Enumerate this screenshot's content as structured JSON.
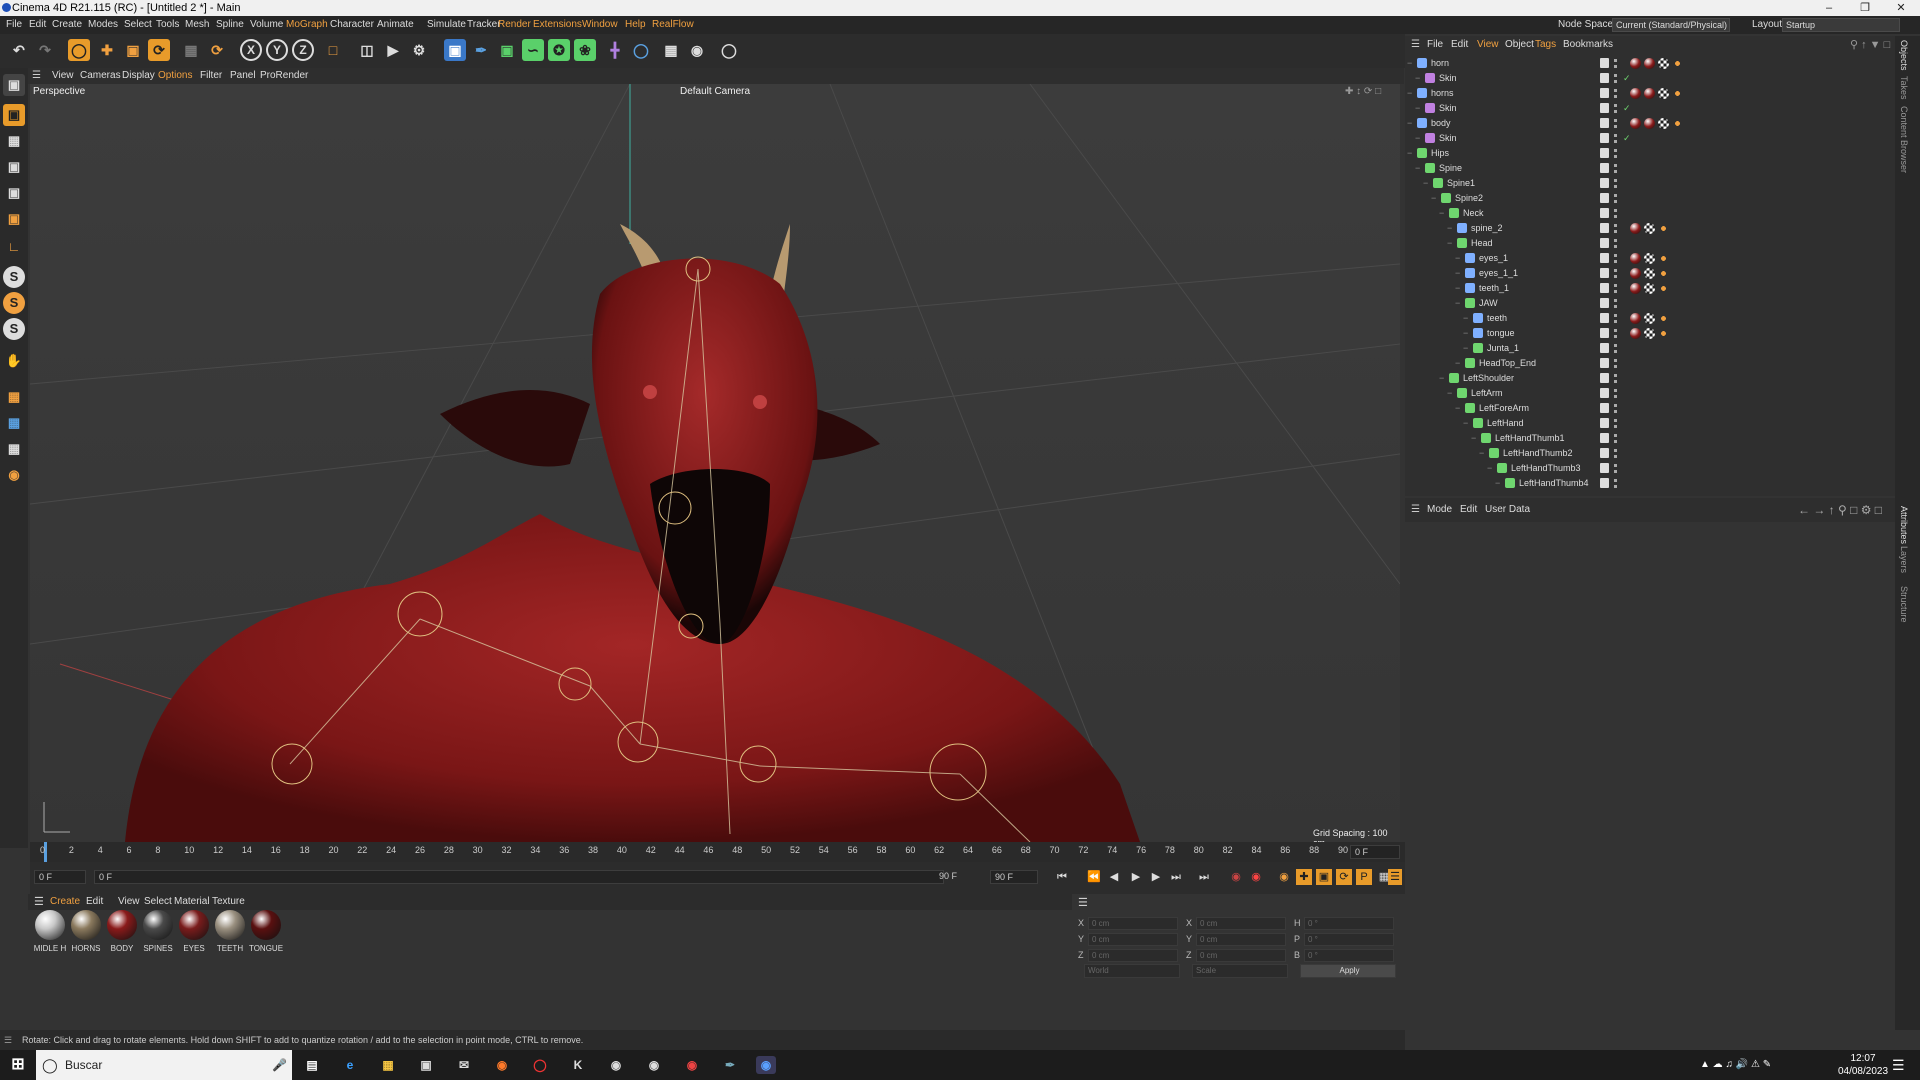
{
  "window": {
    "title": "Cinema 4D R21.115 (RC) - [Untitled 2 *] - Main",
    "controls": [
      "minimize-icon",
      "restore-icon",
      "close-icon"
    ]
  },
  "menubar": {
    "items": [
      "File",
      "Edit",
      "Create",
      "Modes",
      "Select",
      "Tools",
      "Mesh",
      "Spline",
      "Volume",
      "MoGraph",
      "Character",
      "Animate",
      "Simulate",
      "Tracker",
      "Render",
      "Extensions",
      "Window",
      "Help",
      "RealFlow"
    ],
    "node_space_label": "Node Space:",
    "node_space_value": "Current (Standard/Physical)",
    "layout_label": "Layout:",
    "layout_value": "Startup"
  },
  "toolbar": {
    "icons": [
      "undo-icon",
      "redo-icon",
      "live-selection-icon",
      "move-icon",
      "scale-icon",
      "rotate-icon",
      "recent-tools-icon",
      "coordinate-system-icon",
      "x-axis-lock-icon",
      "y-axis-lock-icon",
      "z-axis-lock-icon",
      "world-coordinates-icon",
      "render-region-icon",
      "render-view-icon",
      "render-settings-icon",
      "cube-icon",
      "pen-icon",
      "subdivision-icon",
      "spline-deformer-icon",
      "cloner-icon",
      "mograph-icon",
      "field-icon",
      "floor-icon",
      "camera-icon",
      "light-icon"
    ],
    "axis_labels": [
      "X",
      "Y",
      "Z"
    ]
  },
  "left_tools": [
    "make-editable-icon",
    "checkerboard-icon",
    "points-mode-icon",
    "edges-mode-icon",
    "polygons-mode-icon",
    "uv-mode-icon",
    "axis-mode-icon",
    "snap-icon",
    "soft-selection-icon",
    "workplane-icon",
    "tweak-icon",
    "texture-mode-icon",
    "grid-icon",
    "sculpt-icon",
    "brush-icon"
  ],
  "left_tool_letters": {
    "snap": "S",
    "soft": "S",
    "workplane": "S"
  },
  "viewport": {
    "menu": [
      "View",
      "Cameras",
      "Display",
      "Options",
      "Filter",
      "Panel",
      "ProRender"
    ],
    "active_menu": "Options",
    "view_name": "Perspective",
    "camera": "Default Camera",
    "grid_spacing": "Grid Spacing : 100 cm"
  },
  "timeline": {
    "ticks": [
      "0",
      "2",
      "4",
      "6",
      "8",
      "10",
      "12",
      "14",
      "16",
      "18",
      "20",
      "22",
      "24",
      "26",
      "28",
      "30",
      "32",
      "34",
      "36",
      "38",
      "40",
      "42",
      "44",
      "46",
      "48",
      "50",
      "52",
      "54",
      "56",
      "58",
      "60",
      "62",
      "64",
      "66",
      "68",
      "70",
      "72",
      "74",
      "76",
      "78",
      "80",
      "82",
      "84",
      "86",
      "88",
      "90"
    ],
    "current_frame_display": "0 F"
  },
  "playback": {
    "start_frame": "0 F",
    "current_frame": "0 F",
    "end_frame": "90 F",
    "max_frame": "90 F"
  },
  "materials": {
    "menu": [
      "Create",
      "Edit",
      "View",
      "Select",
      "Material",
      "Texture"
    ],
    "active_menu": "Create",
    "items": [
      {
        "name": "MIDLE H",
        "color": "#c8c8c8"
      },
      {
        "name": "HORNS",
        "color": "#8b7a5e"
      },
      {
        "name": "BODY",
        "color": "#8a1a1a"
      },
      {
        "name": "SPINES",
        "color": "#4a4a4a"
      },
      {
        "name": "EYES",
        "color": "#7a1c1c"
      },
      {
        "name": "TEETH",
        "color": "#9a9080"
      },
      {
        "name": "TONGUE",
        "color": "#5a1010"
      }
    ]
  },
  "coordinates": {
    "rows": [
      {
        "pos_label": "X",
        "pos_value": "0 cm",
        "size_label": "X",
        "size_value": "0 cm",
        "rot_label": "H",
        "rot_value": "0 °"
      },
      {
        "pos_label": "Y",
        "pos_value": "0 cm",
        "size_label": "Y",
        "size_value": "0 cm",
        "rot_label": "P",
        "rot_value": "0 °"
      },
      {
        "pos_label": "Z",
        "pos_value": "0 cm",
        "size_label": "Z",
        "size_value": "0 cm",
        "rot_label": "B",
        "rot_value": "0 °"
      }
    ],
    "space": "World",
    "mode": "Scale",
    "apply": "Apply"
  },
  "status": "Rotate: Click and drag to rotate elements. Hold down SHIFT to add to quantize rotation / add to the selection in point mode, CTRL to remove.",
  "object_manager": {
    "menu": [
      "File",
      "Edit",
      "View",
      "Object",
      "Tags",
      "Bookmarks"
    ],
    "highlight_menu": [
      "View",
      "Tags"
    ],
    "rows": [
      {
        "name": "horn",
        "indent": 0,
        "type": "mesh",
        "tags": [
          "mat-tag",
          "mat-tag",
          "uv-tag",
          "weight-tag"
        ]
      },
      {
        "name": "Skin",
        "indent": 1,
        "type": "skin",
        "tags": []
      },
      {
        "name": "horns",
        "indent": 0,
        "type": "mesh",
        "tags": [
          "mat-tag",
          "mat-tag",
          "uv-tag",
          "weight-tag"
        ]
      },
      {
        "name": "Skin",
        "indent": 1,
        "type": "skin",
        "tags": []
      },
      {
        "name": "body",
        "indent": 0,
        "type": "mesh",
        "tags": [
          "mat-tag",
          "mat-tag",
          "uv-tag",
          "weight-tag"
        ]
      },
      {
        "name": "Skin",
        "indent": 1,
        "type": "skin",
        "tags": []
      },
      {
        "name": "Hips",
        "indent": 0,
        "type": "joint",
        "tags": []
      },
      {
        "name": "Spine",
        "indent": 1,
        "type": "joint",
        "tags": []
      },
      {
        "name": "Spine1",
        "indent": 2,
        "type": "joint",
        "tags": []
      },
      {
        "name": "Spine2",
        "indent": 3,
        "type": "joint",
        "tags": []
      },
      {
        "name": "Neck",
        "indent": 4,
        "type": "joint",
        "tags": []
      },
      {
        "name": "spine_2",
        "indent": 5,
        "type": "mesh",
        "tags": [
          "mat-tag",
          "uv-tag",
          "weight-tag"
        ]
      },
      {
        "name": "Head",
        "indent": 5,
        "type": "joint",
        "tags": []
      },
      {
        "name": "eyes_1",
        "indent": 6,
        "type": "mesh",
        "tags": [
          "mat-tag",
          "uv-tag",
          "weight-tag"
        ]
      },
      {
        "name": "eyes_1_1",
        "indent": 6,
        "type": "mesh",
        "tags": [
          "mat-tag",
          "uv-tag",
          "weight-tag"
        ]
      },
      {
        "name": "teeth_1",
        "indent": 6,
        "type": "mesh",
        "tags": [
          "mat-tag",
          "uv-tag",
          "weight-tag"
        ]
      },
      {
        "name": "JAW",
        "indent": 6,
        "type": "joint",
        "tags": []
      },
      {
        "name": "teeth",
        "indent": 7,
        "type": "mesh",
        "tags": [
          "mat-tag",
          "uv-tag",
          "weight-tag"
        ]
      },
      {
        "name": "tongue",
        "indent": 7,
        "type": "mesh",
        "tags": [
          "mat-tag",
          "uv-tag",
          "weight-tag"
        ]
      },
      {
        "name": "Junta_1",
        "indent": 7,
        "type": "joint",
        "tags": []
      },
      {
        "name": "HeadTop_End",
        "indent": 6,
        "type": "joint",
        "tags": []
      },
      {
        "name": "LeftShoulder",
        "indent": 4,
        "type": "joint",
        "tags": []
      },
      {
        "name": "LeftArm",
        "indent": 5,
        "type": "joint",
        "tags": []
      },
      {
        "name": "LeftForeArm",
        "indent": 6,
        "type": "joint",
        "tags": []
      },
      {
        "name": "LeftHand",
        "indent": 7,
        "type": "joint",
        "tags": []
      },
      {
        "name": "LeftHandThumb1",
        "indent": 8,
        "type": "joint",
        "tags": []
      },
      {
        "name": "LeftHandThumb2",
        "indent": 9,
        "type": "joint",
        "tags": []
      },
      {
        "name": "LeftHandThumb3",
        "indent": 10,
        "type": "joint",
        "tags": []
      },
      {
        "name": "LeftHandThumb4",
        "indent": 11,
        "type": "joint",
        "tags": []
      }
    ]
  },
  "attribute_manager": {
    "menu": [
      "Mode",
      "Edit",
      "User Data"
    ]
  },
  "side_tabs": [
    "Objects",
    "Takes",
    "Content Browser",
    "Attributes",
    "Layers",
    "Structure"
  ],
  "taskbar": {
    "search_placeholder": "Buscar",
    "time": "12:07",
    "date": "04/08/2023"
  },
  "colors": {
    "accent": "#f0a040",
    "joint": "#6fd66f",
    "mesh": "#7fb0ff",
    "body_red": "#8a1a1a"
  }
}
